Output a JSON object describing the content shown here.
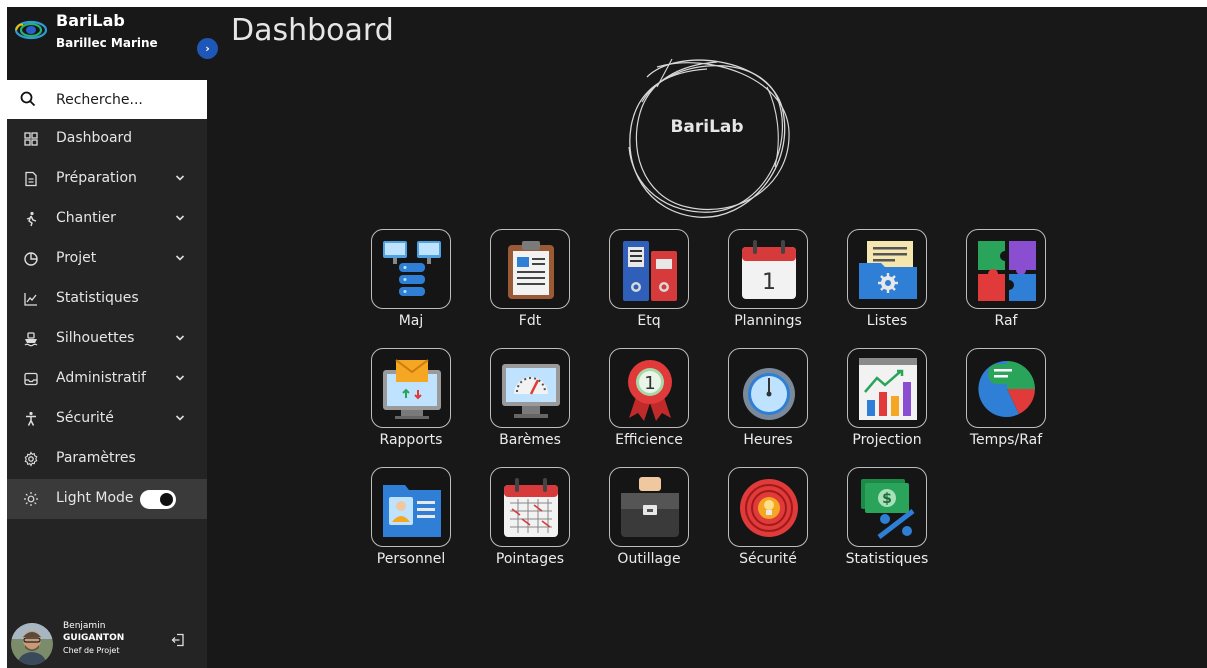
{
  "brand": {
    "title": "BariLab",
    "subtitle": "Barillec Marine"
  },
  "search": {
    "placeholder": "Recherche..."
  },
  "sidebar": {
    "items": [
      {
        "label": "Dashboard"
      },
      {
        "label": "Préparation"
      },
      {
        "label": "Chantier"
      },
      {
        "label": "Projet"
      },
      {
        "label": "Statistiques"
      },
      {
        "label": "Silhouettes"
      },
      {
        "label": "Administratif"
      },
      {
        "label": "Sécurité"
      },
      {
        "label": "Paramètres"
      }
    ],
    "light_mode": {
      "label": "Light Mode",
      "enabled": true
    }
  },
  "user": {
    "first_name": "Benjamin",
    "last_name": "GUIGANTON",
    "role": "Chef de Projet"
  },
  "main": {
    "title": "Dashboard",
    "logo_text": "BariLab",
    "tiles": [
      {
        "label": "Maj",
        "icon": "server-sync-icon"
      },
      {
        "label": "Fdt",
        "icon": "clipboard-icon"
      },
      {
        "label": "Etq",
        "icon": "binders-icon"
      },
      {
        "label": "Plannings",
        "icon": "calendar-icon"
      },
      {
        "label": "Listes",
        "icon": "folder-settings-icon"
      },
      {
        "label": "Raf",
        "icon": "puzzle-icon"
      },
      {
        "label": "Rapports",
        "icon": "mail-monitor-icon"
      },
      {
        "label": "Barèmes",
        "icon": "gauge-monitor-icon"
      },
      {
        "label": "Efficience",
        "icon": "award-ribbon-icon"
      },
      {
        "label": "Heures",
        "icon": "stopwatch-icon"
      },
      {
        "label": "Projection",
        "icon": "growth-chart-icon"
      },
      {
        "label": "Temps/Raf",
        "icon": "pie-chat-icon"
      },
      {
        "label": "Personnel",
        "icon": "id-folder-icon"
      },
      {
        "label": "Pointages",
        "icon": "calendar-check-icon"
      },
      {
        "label": "Outillage",
        "icon": "toolbox-icon"
      },
      {
        "label": "Sécurité",
        "icon": "target-bulb-icon"
      },
      {
        "label": "Statistiques",
        "icon": "money-percent-icon"
      }
    ]
  },
  "colors": {
    "accent": "#1f57b8",
    "sidebar_bg": "#242424",
    "main_bg": "#181818",
    "active_bg": "#3a3a3a"
  }
}
